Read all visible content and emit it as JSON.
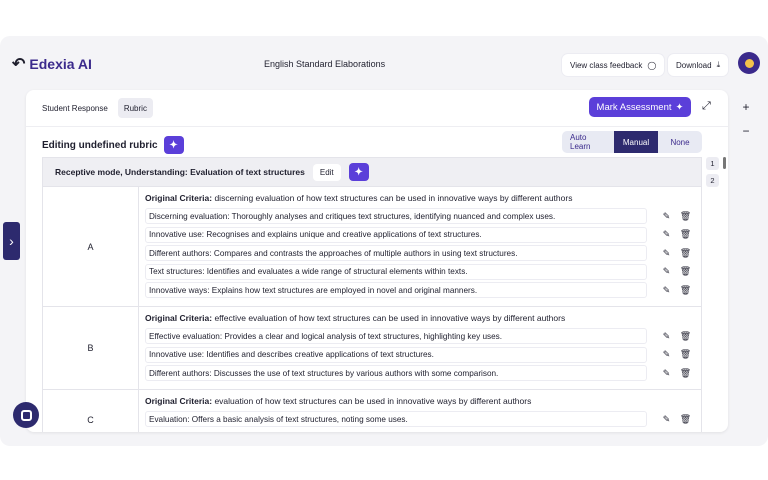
{
  "app": {
    "name": "Edexia AI",
    "title": "English Standard Elaborations"
  },
  "toolbar": {
    "view_feedback": "View class feedback",
    "download": "Download"
  },
  "tabs": [
    {
      "label": "Student Response"
    },
    {
      "label": "Rubric"
    }
  ],
  "mark_button": "Mark Assessment",
  "editing_title": "Editing undefined rubric",
  "modes": [
    {
      "label": "Auto Learn"
    },
    {
      "label": "Manual"
    },
    {
      "label": "None"
    }
  ],
  "criterion": {
    "title": "Receptive mode, Understanding: Evaluation of text structures",
    "edit_label": "Edit"
  },
  "orig_label": "Original Criteria:",
  "grades": [
    {
      "grade": "A",
      "original": "discerning evaluation of how text structures can be used in innovative ways by different authors",
      "items": [
        "Discerning evaluation: Thoroughly analyses and critiques text structures, identifying nuanced and complex uses.",
        "Innovative use: Recognises and explains unique and creative applications of text structures.",
        "Different authors: Compares and contrasts the approaches of multiple authors in using text structures.",
        "Text structures: Identifies and evaluates a wide range of structural elements within texts.",
        "Innovative ways: Explains how text structures are employed in novel and original manners."
      ]
    },
    {
      "grade": "B",
      "original": "effective evaluation of how text structures can be used in innovative ways by different authors",
      "items": [
        "Effective evaluation: Provides a clear and logical analysis of text structures, highlighting key uses.",
        "Innovative use: Identifies and describes creative applications of text structures.",
        "Different authors: Discusses the use of text structures by various authors with some comparison."
      ]
    },
    {
      "grade": "C",
      "original": "evaluation of how text structures can be used in innovative ways by different authors",
      "items": [
        "Evaluation: Offers a basic analysis of text structures, noting some uses."
      ]
    }
  ],
  "pages": [
    "1",
    "2"
  ],
  "zoom": {
    "in": "+",
    "out": "−"
  }
}
